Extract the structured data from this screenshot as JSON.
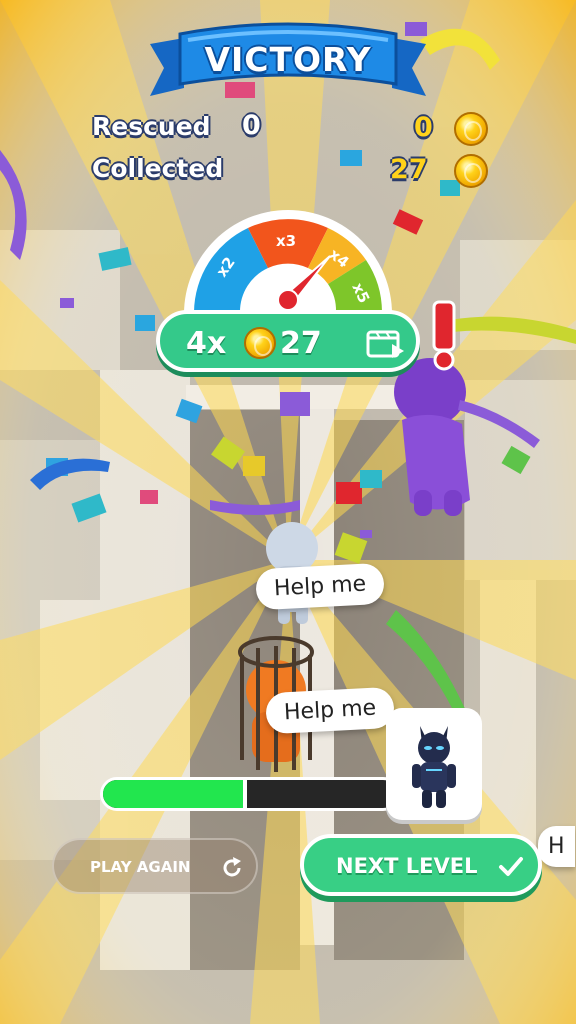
{
  "banner": {
    "title": "VICTORY"
  },
  "stats": {
    "rescued_label": "Rescued",
    "rescued_count": "0",
    "rescued_coins": "0",
    "collected_label": "Collected",
    "collected_count": "27"
  },
  "multiplier_wheel": {
    "segments": [
      "x2",
      "x3",
      "x4",
      "x5"
    ],
    "segment_colors": [
      "#1fa1e6",
      "#f2551c",
      "#f7b424",
      "#7ec62a"
    ],
    "pointer_on": "x4"
  },
  "multiplier_reward": {
    "multiplier": "4x",
    "amount": "27",
    "icon": "video-ad-icon"
  },
  "speech": {
    "bubble_1": "Help me",
    "bubble_2": "Help me",
    "bubble_3": "H"
  },
  "alert": {
    "icon": "exclamation-icon",
    "color": "#e0262e"
  },
  "progress": {
    "fraction": 0.49,
    "fill_color": "#22e64e"
  },
  "skin_unlock": {
    "icon": "dark-hero-skin-icon"
  },
  "buttons": {
    "play_again": "PLAY AGAIN",
    "next_level": "NEXT LEVEL"
  },
  "colors": {
    "primary_green": "#38cf85",
    "banner_blue": "#1e8ae6",
    "coin_gold": "#ffd21a"
  }
}
